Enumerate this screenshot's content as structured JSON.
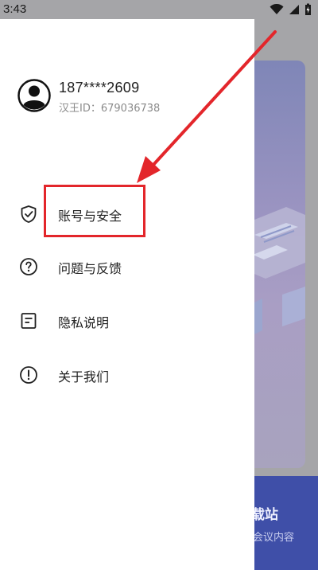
{
  "status_bar": {
    "time": "3:43"
  },
  "user": {
    "phone": "187****2609",
    "id_label": "汉王ID：",
    "id_value": "679036738"
  },
  "menu": [
    {
      "label": "账号与安全",
      "icon": "shield-check-icon"
    },
    {
      "label": "问题与反馈",
      "icon": "question-circle-icon"
    },
    {
      "label": "隐私说明",
      "icon": "document-icon"
    },
    {
      "label": "关于我们",
      "icon": "info-exclamation-icon"
    }
  ],
  "background": {
    "title": "载站",
    "subtitle": "会议内容"
  },
  "colors": {
    "highlight": "#e3262b",
    "drawer_bg": "#ffffff",
    "bg_bottom": "#3f4fa8"
  }
}
